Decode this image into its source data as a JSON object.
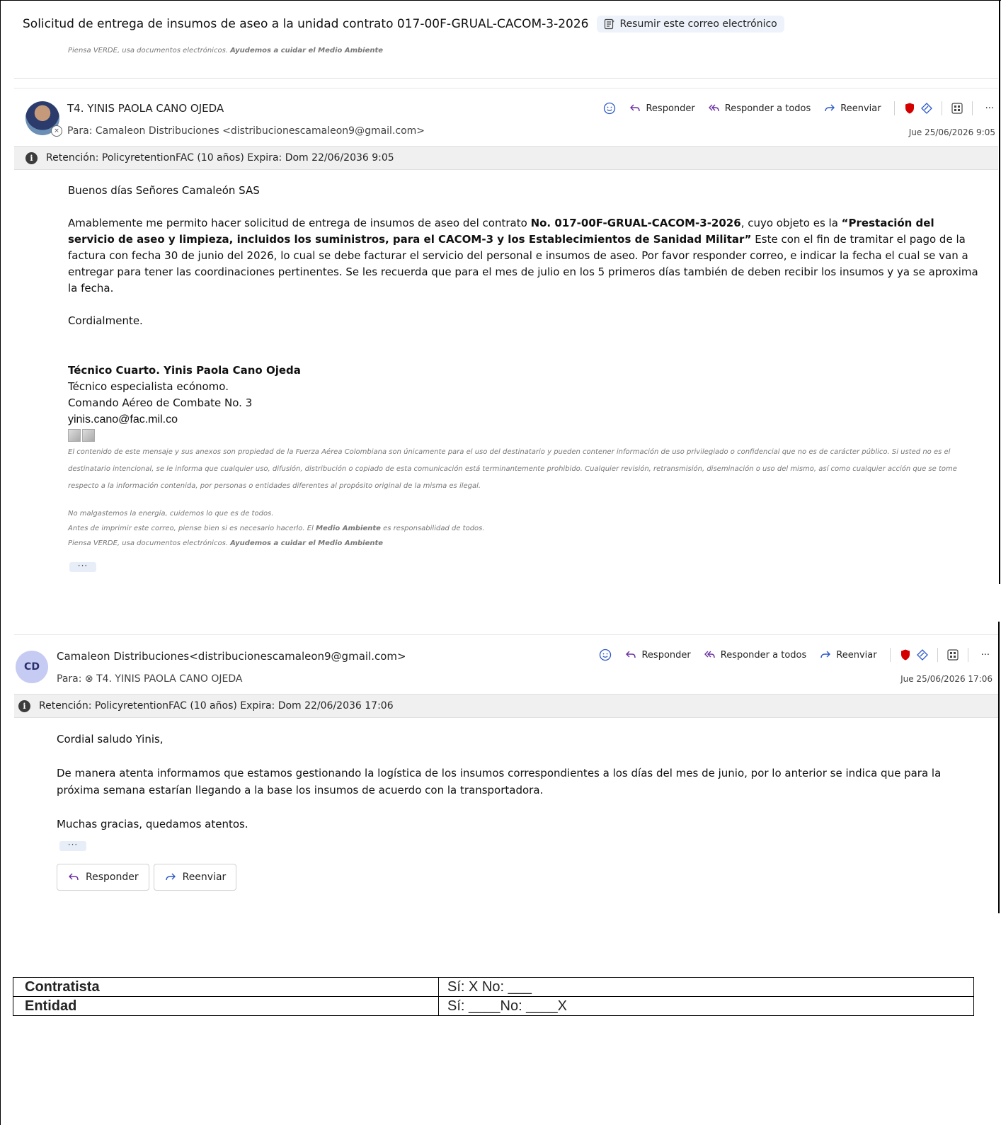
{
  "subject": {
    "title": "Solicitud de entrega de insumos de aseo a la unidad contrato  017-00F-GRUAL-CACOM-3-2026",
    "summarize_label": "Resumir este correo electrónico"
  },
  "footer_prev": {
    "line_plain": "Piensa VERDE, usa documentos electrónicos. ",
    "line_bold": "Ayudemos  a cuidar el Medio Ambiente"
  },
  "message1": {
    "sender": "T4. YINIS PAOLA CANO OJEDA",
    "to": "Para:  Camaleon Distribuciones <distribucionescamaleon9@gmail.com>",
    "date": "Jue 25/06/2026 9:05",
    "actions": {
      "reply": "Responder",
      "reply_all": "Responder a todos",
      "forward": "Reenviar",
      "more": "···"
    },
    "retention": "Retención: PolicyretentionFAC (10 años) Expira: Dom 22/06/2036 9:05",
    "greeting": "Buenos días Señores Camaleón SAS",
    "para_1": "Amablemente me permito hacer solicitud de entrega de insumos de aseo del contrato ",
    "para_contract": "No. 017-00F-GRUAL-CACOM-3-2026",
    "para_2": ", cuyo objeto es la ",
    "para_object": "“Prestación del servicio de aseo y limpieza, incluidos los suministros, para el CACOM-3 y los Establecimientos de Sanidad Militar”",
    "para_3": " Este con el fin de tramitar el pago de la factura con fecha 30 de junio del 2026, lo cual se debe facturar el servicio del personal e insumos de aseo. Por favor responder correo, e indicar la fecha el cual se van a entregar para tener las coordinaciones pertinentes.  Se les recuerda que para el mes de julio en los 5 primeros días también de deben recibir los insumos y ya se aproxima la fecha.",
    "closing": "Cordialmente.",
    "signature": {
      "name": "Técnico Cuarto. Yinis Paola Cano Ojeda",
      "role": "Técnico especialista ecónomo.",
      "unit": "Comando Aéreo de Combate No. 3",
      "email": "yinis.cano@fac.mil.co"
    },
    "disclaimer": "El contenido de este mensaje y sus anexos son propiedad de la Fuerza Aérea Colombiana son únicamente para el uso del destinatario y pueden contener información de uso privilegiado o confidencial que no es de carácter público. Si usted no es el destinatario intencional, se  le informa que cualquier uso, difusión, distribución o copiado de esta comunicación está terminantemente prohibido. Cualquier revisión, retransmisión, diseminación o uso del mismo, así como cualquier acción que se tome respecto a la información contenida, por personas o entidades diferentes al propósito original de la misma es ilegal.",
    "eco_1": "No malgastemos la energía, cuidemos lo que es de todos.",
    "eco_2a": "Antes de imprimir este correo, piense bien si es necesario hacerlo. El ",
    "eco_2b": "Medio Ambiente",
    "eco_2c": " es responsabilidad de todos.",
    "eco_3a": "Piensa VERDE, usa documentos electrónicos. ",
    "eco_3b": "Ayudemos  a cuidar el Medio Ambiente",
    "ellipsis": "···"
  },
  "message2": {
    "avatar_initials": "CD",
    "sender": "Camaleon Distribuciones<distribucionescamaleon9@gmail.com>",
    "to": "Para:  ⊗ T4. YINIS PAOLA CANO OJEDA",
    "date": "Jue 25/06/2026 17:06",
    "actions": {
      "reply": "Responder",
      "reply_all": "Responder a todos",
      "forward": "Reenviar",
      "more": "···"
    },
    "retention": "Retención: PolicyretentionFAC (10 años) Expira: Dom 22/06/2036 17:06",
    "greeting": "Cordial saludo Yinis,",
    "paragraph": "De manera atenta informamos que estamos gestionando la logística de los insumos correspondientes a los días del mes de junio, por lo anterior se indica que para la próxima semana estarían llegando a la base los insumos de acuerdo con la transportadora.",
    "closing": "Muchas gracias, quedamos atentos.",
    "ellipsis": "···",
    "reply_button": "Responder",
    "forward_button": "Reenviar"
  },
  "table": {
    "rows": [
      {
        "label": "Contratista",
        "value": "Sí: X No: ___"
      },
      {
        "label": "Entidad",
        "value": "Sí: ____No: ____X"
      }
    ]
  },
  "colors": {
    "accent": "#6b2fa0",
    "shield": "#d40000",
    "avatar_cd": "#c5cbf2",
    "retention_bg": "#f0f0f0"
  }
}
